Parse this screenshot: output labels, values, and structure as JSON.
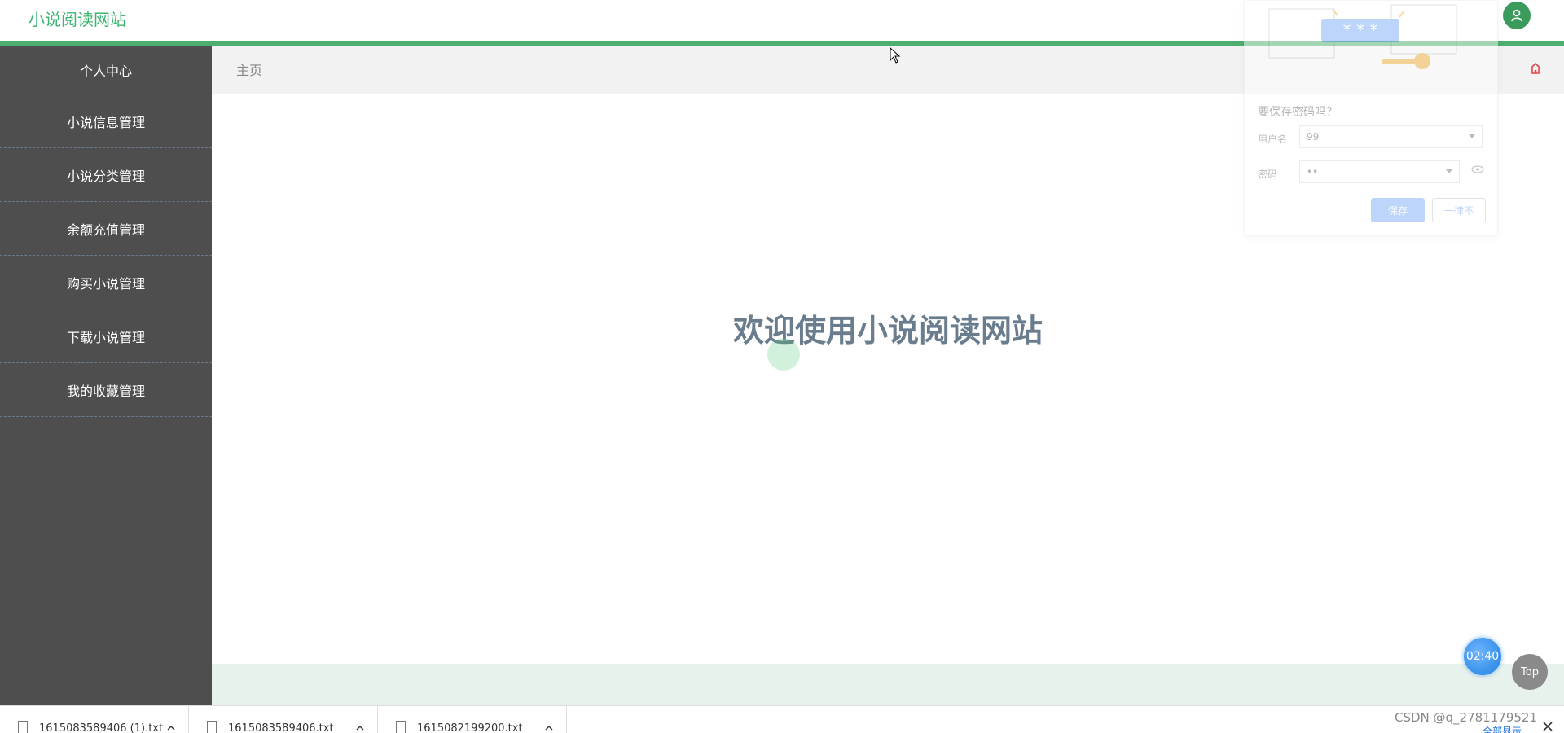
{
  "header": {
    "site_title": "小说阅读网站",
    "brand_color": "#3cb371",
    "accent_line_color": "#4caf6e",
    "avatar_icon": "user-icon"
  },
  "sidebar": {
    "items": [
      {
        "label": "个人中心"
      },
      {
        "label": "小说信息管理"
      },
      {
        "label": "小说分类管理"
      },
      {
        "label": "余额充值管理"
      },
      {
        "label": "购买小说管理"
      },
      {
        "label": "下载小说管理"
      },
      {
        "label": "我的收藏管理"
      }
    ]
  },
  "breadcrumb": {
    "label": "主页",
    "home_icon": "home-icon"
  },
  "main": {
    "welcome_text": "欢迎使用小说阅读网站"
  },
  "password_popup": {
    "question": "要保存密码吗？",
    "username_label": "用户名",
    "username_value": "99",
    "password_label": "密码",
    "password_value": "••",
    "save_label": "保存",
    "never_label": "一律不"
  },
  "widgets": {
    "timer": "02:40",
    "top_label": "Top"
  },
  "downloads": {
    "files": [
      {
        "name": "1615083589406 (1).txt"
      },
      {
        "name": "1615083589406.txt"
      },
      {
        "name": "1615082199200.txt"
      }
    ],
    "show_all_label": "全部显示",
    "watermark": "CSDN @q_2781179521"
  }
}
